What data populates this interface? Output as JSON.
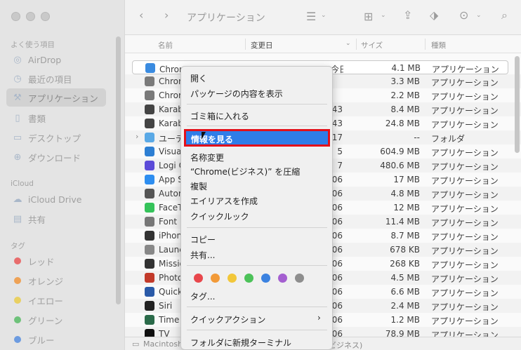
{
  "sidebar": {
    "favorites_title": "よく使う項目",
    "favorites": [
      {
        "label": "AirDrop",
        "icon": "airdrop-icon"
      },
      {
        "label": "最近の項目",
        "icon": "clock-icon"
      },
      {
        "label": "アプリケーション",
        "icon": "applications-icon"
      },
      {
        "label": "書類",
        "icon": "document-icon"
      },
      {
        "label": "デスクトップ",
        "icon": "desktop-icon"
      },
      {
        "label": "ダウンロード",
        "icon": "download-icon"
      }
    ],
    "icloud_title": "iCloud",
    "icloud": [
      {
        "label": "iCloud Drive",
        "icon": "cloud-icon"
      },
      {
        "label": "共有",
        "icon": "shared-folder-icon"
      }
    ],
    "tags_title": "タグ",
    "tags": [
      {
        "label": "レッド",
        "color": "#e86d6d"
      },
      {
        "label": "オレンジ",
        "color": "#eea256"
      },
      {
        "label": "イエロー",
        "color": "#e9d062"
      },
      {
        "label": "グリーン",
        "color": "#6ec27a"
      },
      {
        "label": "ブルー",
        "color": "#6c9be0"
      }
    ]
  },
  "toolbar": {
    "title": "アプリケーション"
  },
  "columns": {
    "name": "名前",
    "date": "変更日",
    "size": "サイズ",
    "kind": "種類"
  },
  "rows": [
    {
      "name": "Chrome(ビジネス)",
      "date": "今日 15:54",
      "size": "4.1 MB",
      "kind": "アプリケーション",
      "icon": "chrome-icon",
      "color": "#3a8be0"
    },
    {
      "name": "Chrome",
      "date": "",
      "size": "3.3 MB",
      "kind": "アプリケーション",
      "icon": "chrome-icon",
      "color": "#7a7a7a"
    },
    {
      "name": "Chrome",
      "date": "",
      "size": "2.2 MB",
      "kind": "アプリケーション",
      "icon": "chrome-icon",
      "color": "#7a7a7a"
    },
    {
      "name": "Karabiner",
      "date": "43",
      "size": "8.4 MB",
      "kind": "アプリケーション",
      "icon": "karabiner-icon",
      "color": "#444"
    },
    {
      "name": "Karabiner",
      "date": "43",
      "size": "24.8 MB",
      "kind": "アプリケーション",
      "icon": "karabiner-icon",
      "color": "#444"
    },
    {
      "name": "ユーティリティ",
      "date": "17",
      "size": "--",
      "kind": "フォルダ",
      "icon": "folder-icon",
      "color": "#5aa9e6",
      "folder": true
    },
    {
      "name": "Visual Studio Code",
      "date": "5",
      "size": "604.9 MB",
      "kind": "アプリケーション",
      "icon": "vscode-icon",
      "color": "#2d7fd3"
    },
    {
      "name": "Logi Options",
      "date": "7",
      "size": "480.6 MB",
      "kind": "アプリケーション",
      "icon": "logi-icon",
      "color": "#5c4bd8"
    },
    {
      "name": "App Store",
      "date": "06",
      "size": "17 MB",
      "kind": "アプリケーション",
      "icon": "app-store-icon",
      "color": "#2e8ef0"
    },
    {
      "name": "Automator",
      "date": "06",
      "size": "4.8 MB",
      "kind": "アプリケーション",
      "icon": "automator-icon",
      "color": "#555"
    },
    {
      "name": "FaceTime",
      "date": "06",
      "size": "12 MB",
      "kind": "アプリケーション",
      "icon": "facetime-icon",
      "color": "#35c35a"
    },
    {
      "name": "Font Book",
      "date": "06",
      "size": "11.4 MB",
      "kind": "アプリケーション",
      "icon": "font-book-icon",
      "color": "#777"
    },
    {
      "name": "iPhone",
      "date": "06",
      "size": "8.7 MB",
      "kind": "アプリケーション",
      "icon": "iphone-icon",
      "color": "#333"
    },
    {
      "name": "Launchpad",
      "date": "06",
      "size": "678 KB",
      "kind": "アプリケーション",
      "icon": "launchpad-icon",
      "color": "#888"
    },
    {
      "name": "Mission Control",
      "date": "06",
      "size": "268 KB",
      "kind": "アプリケーション",
      "icon": "mission-control-icon",
      "color": "#333"
    },
    {
      "name": "Photo Booth",
      "date": "06",
      "size": "4.5 MB",
      "kind": "アプリケーション",
      "icon": "photo-booth-icon",
      "color": "#c23a2a"
    },
    {
      "name": "QuickTime",
      "date": "06",
      "size": "6.6 MB",
      "kind": "アプリケーション",
      "icon": "quicktime-icon",
      "color": "#2a5aa8"
    },
    {
      "name": "Siri",
      "date": "06",
      "size": "2.4 MB",
      "kind": "アプリケーション",
      "icon": "siri-icon",
      "color": "#222"
    },
    {
      "name": "Time Machine",
      "date": "06",
      "size": "1.2 MB",
      "kind": "アプリケーション",
      "icon": "time-machine-icon",
      "color": "#2b6b4a"
    },
    {
      "name": "TV",
      "date": "06",
      "size": "78.9 MB",
      "kind": "アプリケーション",
      "icon": "tv-icon",
      "color": "#111"
    }
  ],
  "pathbar": {
    "disk": "Macintosh",
    "tail": "ビジネス)"
  },
  "menu": {
    "items": [
      {
        "id": "open",
        "label": "開く"
      },
      {
        "id": "show-package",
        "label": "パッケージの内容を表示"
      },
      {
        "id": "trash",
        "label": "ゴミ箱に入れる"
      },
      {
        "id": "get-info",
        "label": "情報を見る"
      },
      {
        "id": "rename",
        "label": "名称変更"
      },
      {
        "id": "compress",
        "label": "“Chrome(ビジネス)” を圧縮"
      },
      {
        "id": "duplicate",
        "label": "複製"
      },
      {
        "id": "alias",
        "label": "エイリアスを作成"
      },
      {
        "id": "quicklook",
        "label": "クイックルック"
      },
      {
        "id": "copy",
        "label": "コピー"
      },
      {
        "id": "share",
        "label": "共有..."
      },
      {
        "id": "tags",
        "label": "タグ..."
      },
      {
        "id": "quick-actions",
        "label": "クイックアクション"
      },
      {
        "id": "new-terminal",
        "label": "フォルダに新規ターミナル"
      }
    ],
    "tag_colors": [
      "#e8474c",
      "#f29a38",
      "#f2c73a",
      "#4cc259",
      "#3b82e0",
      "#a45fd0",
      "#8e8e8e"
    ]
  }
}
